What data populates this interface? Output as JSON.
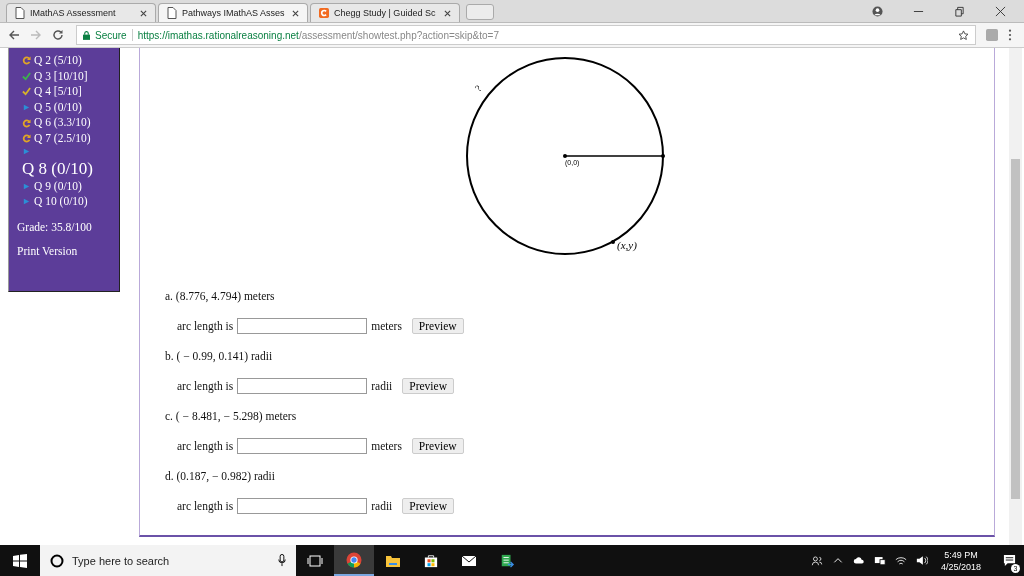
{
  "browser": {
    "tabs": [
      {
        "title": "IMathAS Assessment",
        "kind": "page",
        "selected": false
      },
      {
        "title": "Pathways IMathAS Asses",
        "kind": "page",
        "selected": true
      },
      {
        "title": "Chegg Study | Guided Sc",
        "kind": "chegg",
        "selected": false
      }
    ],
    "secure_label": "Secure",
    "url_host": "https://imathas.rationalreasoning.net",
    "url_path": "/assessment/showtest.php?action=skip&to=7"
  },
  "sidebar": {
    "questions": [
      {
        "label": "Q 2 (5/10)",
        "kind": "retry",
        "selected": false
      },
      {
        "label": "Q 3 [10/10]",
        "kind": "full",
        "selected": false
      },
      {
        "label": "Q 4 [5/10]",
        "kind": "partial",
        "selected": false
      },
      {
        "label": "Q 5 (0/10)",
        "kind": "untried",
        "selected": false
      },
      {
        "label": "Q 6 (3.3/10)",
        "kind": "retry",
        "selected": false
      },
      {
        "label": "Q 7 (2.5/10)",
        "kind": "retry",
        "selected": false
      },
      {
        "label": "Q 8 (0/10)",
        "kind": "untried",
        "selected": true
      },
      {
        "label": "Q 9 (0/10)",
        "kind": "untried",
        "selected": false
      },
      {
        "label": "Q 10 (0/10)",
        "kind": "untried",
        "selected": false
      }
    ],
    "grade": "Grade: 35.8/100",
    "print_link": "Print Version"
  },
  "figure": {
    "arc_label": "?",
    "center_label": "(0,0)",
    "point_label": "(x,y)"
  },
  "parts": [
    {
      "prompt": "a. (8.776, 4.794) meters",
      "answer_label": "arc length is",
      "unit": "meters",
      "button": "Preview"
    },
    {
      "prompt": "b. ( − 0.99, 0.141) radii",
      "answer_label": "arc length is",
      "unit": "radii",
      "button": "Preview"
    },
    {
      "prompt": "c. ( − 8.481,  − 5.298) meters",
      "answer_label": "arc length is",
      "unit": "meters",
      "button": "Preview"
    },
    {
      "prompt": "d. (0.187,  − 0.982) radii",
      "answer_label": "arc length is",
      "unit": "radii",
      "button": "Preview"
    }
  ],
  "taskbar": {
    "search_placeholder": "Type here to search",
    "time": "5:49 PM",
    "date": "4/25/2018",
    "notification_count": "3"
  }
}
